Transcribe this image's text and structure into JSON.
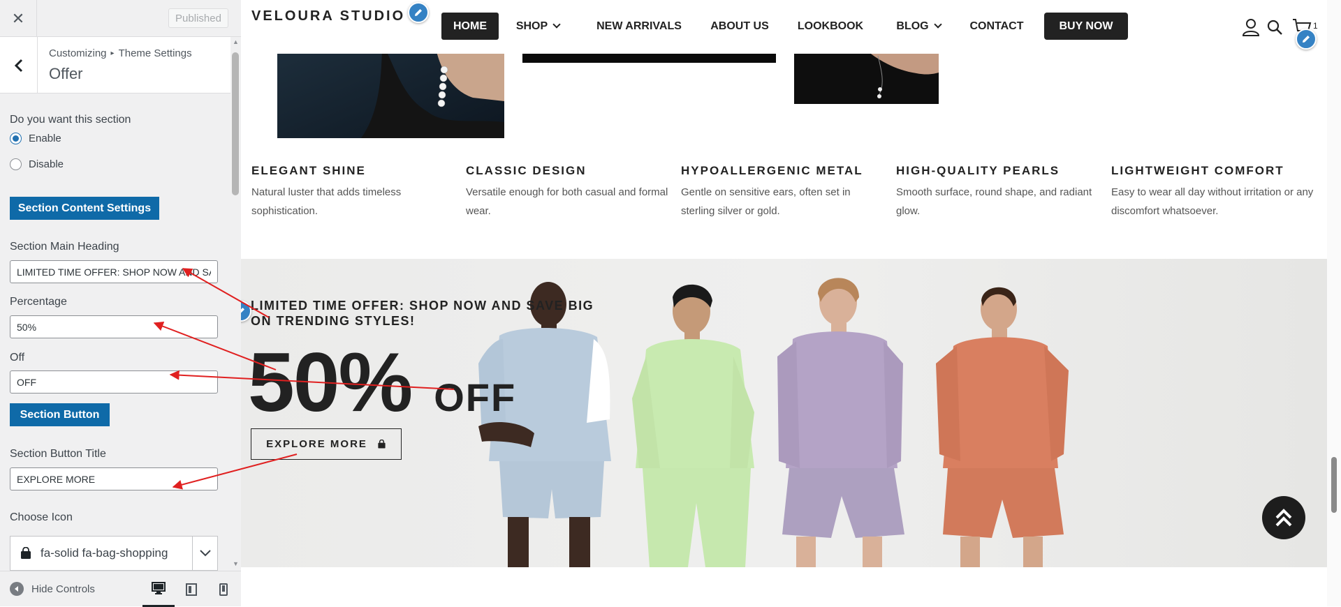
{
  "customizer": {
    "published_label": "Published",
    "breadcrumb": {
      "root": "Customizing",
      "separator": "▸",
      "parent": "Theme Settings"
    },
    "section_title": "Offer",
    "enable_question": "Do you want this section",
    "radio_enable": "Enable",
    "radio_disable": "Disable",
    "selected_option": "Enable",
    "content_settings_button": "Section Content Settings",
    "main_heading_label": "Section Main Heading",
    "main_heading_value": "LIMITED TIME OFFER: SHOP NOW AND SAVE",
    "percentage_label": "Percentage",
    "percentage_value": "50%",
    "off_label": "Off",
    "off_value": "OFF",
    "section_button_button": "Section Button",
    "button_title_label": "Section Button Title",
    "button_title_value": "EXPLORE MORE",
    "choose_icon_label": "Choose Icon",
    "icon_value": "fa-solid fa-bag-shopping",
    "hide_controls": "Hide Controls",
    "devices": [
      "desktop-icon",
      "tablet-icon",
      "mobile-icon"
    ]
  },
  "site": {
    "logo": "VELOURA STUDIO",
    "nav": [
      {
        "label": "HOME",
        "active": true
      },
      {
        "label": "SHOP",
        "dropdown": true
      },
      {
        "label": "NEW ARRIVALS"
      },
      {
        "label": "ABOUT US"
      },
      {
        "label": "LOOKBOOK"
      },
      {
        "label": "BLOG",
        "dropdown": true
      },
      {
        "label": "CONTACT"
      }
    ],
    "buy_now": "BUY NOW",
    "cart_count": "1",
    "features": [
      {
        "title": "ELEGANT SHINE",
        "desc": "Natural luster that adds timeless sophistication."
      },
      {
        "title": "CLASSIC DESIGN",
        "desc": "Versatile enough for both casual and formal wear."
      },
      {
        "title": "HYPOALLERGENIC METAL",
        "desc": "Gentle on sensitive ears, often set in sterling silver or gold."
      },
      {
        "title": "HIGH-QUALITY PEARLS",
        "desc": "Smooth surface, round shape, and radiant glow."
      },
      {
        "title": "LIGHTWEIGHT COMFORT",
        "desc": "Easy to wear all day without irritation or any discomfort whatsoever."
      }
    ],
    "offer": {
      "heading": "LIMITED TIME OFFER: SHOP NOW AND SAVE BIG ON TRENDING STYLES!",
      "percentage": "50%",
      "off": "OFF",
      "button": "EXPLORE MORE"
    }
  },
  "colors": {
    "wp_blue": "#0f6aa8",
    "dark": "#222222",
    "annotation_red": "#e02020",
    "pencil_blue": "#3582c4"
  }
}
